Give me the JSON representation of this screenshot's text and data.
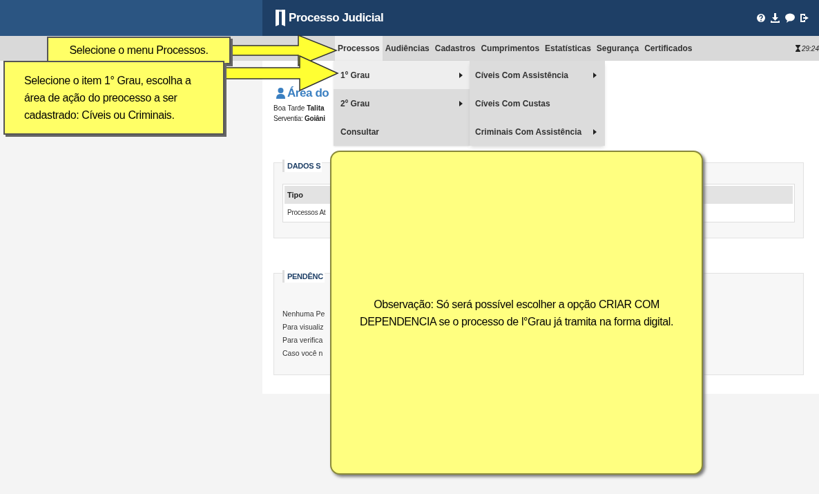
{
  "header": {
    "title": "Processo Judicial",
    "timer": "29:24"
  },
  "menu": [
    {
      "label": "Processos",
      "selected": true
    },
    {
      "label": "Audiências",
      "selected": false
    },
    {
      "label": "Cadastros",
      "selected": false
    },
    {
      "label": "Cumprimentos",
      "selected": false
    },
    {
      "label": "Estatísticas",
      "selected": false
    },
    {
      "label": "Segurança",
      "selected": false
    },
    {
      "label": "Certificados",
      "selected": false
    }
  ],
  "dropdown": [
    {
      "label": "1º Grau",
      "submenu": true,
      "selected": true
    },
    {
      "label": "2º Grau",
      "submenu": true,
      "selected": false
    },
    {
      "label": "Consultar",
      "submenu": false,
      "selected": false
    }
  ],
  "submenu": [
    {
      "label": "Cíveis Com Assistência",
      "submenu": true
    },
    {
      "label": "Cíveis Com Custas",
      "submenu": false
    },
    {
      "label": "Criminais Com Assistência",
      "submenu": true
    }
  ],
  "page": {
    "heading": "Área do",
    "greeting": "Boa Tarde **Talita**",
    "serventia": "Serventia: **Goiâni**",
    "sections": [
      {
        "title": "DADOS S",
        "table": {
          "columns": [
            "Tipo"
          ],
          "rows": [
            [
              "Processos At"
            ]
          ]
        }
      },
      {
        "title": "PENDÊNC",
        "lines": [
          "Nenhuma Pe",
          "Para visualiz",
          "Para verifica",
          "Caso você n"
        ]
      }
    ]
  },
  "callouts": [
    {
      "text": "Selecione o menu Processos."
    },
    {
      "text": "Selecione o item 1° Grau, escolha a área de ação do preocesso a ser cadastrado: Cíveis ou Criminais."
    }
  ],
  "note": {
    "text": "Observação: Só será possível escolher a opção CRIAR COM DEPENDENCIA se o processo de l°Grau já tramita na forma digital."
  }
}
